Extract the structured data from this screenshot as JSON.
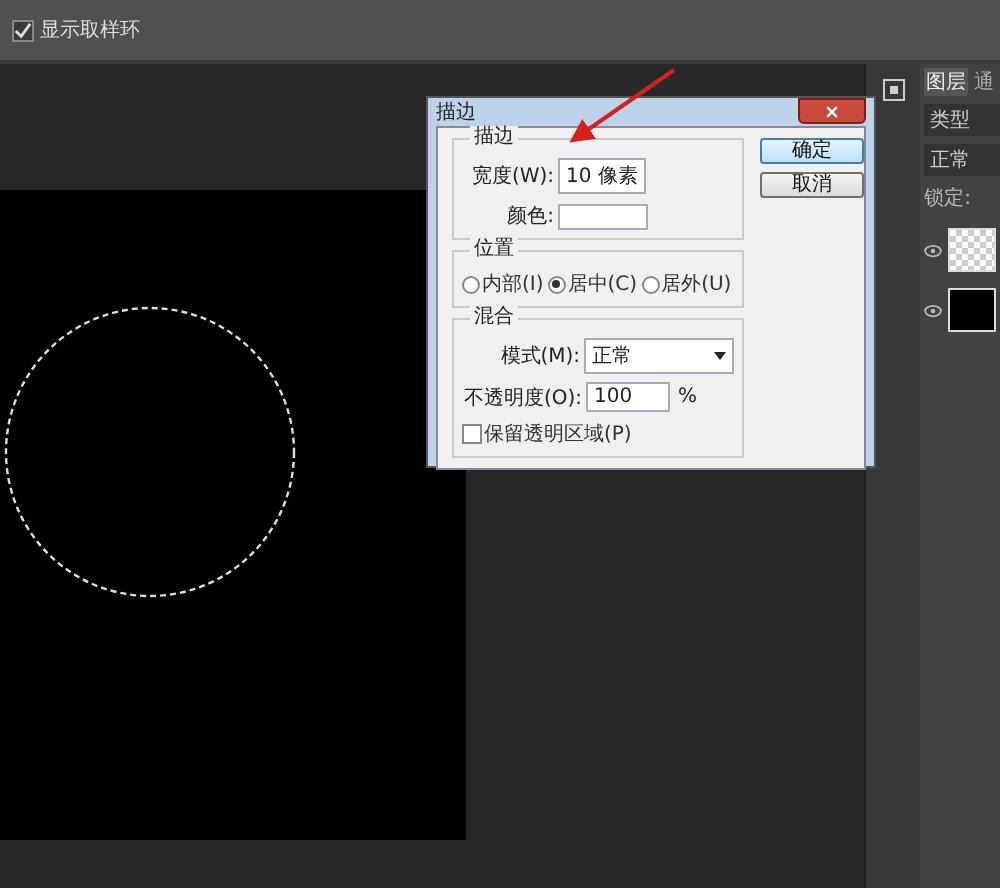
{
  "options_bar": {
    "sample_ring": {
      "label": "显示取样环",
      "checked": true
    }
  },
  "dialog": {
    "title": "描边",
    "stroke": {
      "legend": "描边",
      "width_label": "宽度(W):",
      "width_value": "10 像素",
      "color_label": "颜色:"
    },
    "position": {
      "legend": "位置",
      "options": [
        {
          "label": "内部(I)",
          "selected": false
        },
        {
          "label": "居中(C)",
          "selected": true
        },
        {
          "label": "居外(U)",
          "selected": false
        }
      ]
    },
    "blend": {
      "legend": "混合",
      "mode_label": "模式(M):",
      "mode_value": "正常",
      "opacity_label": "不透明度(O):",
      "opacity_value": "100",
      "opacity_unit": "%",
      "preserve": {
        "label": "保留透明区域(P)",
        "checked": false
      }
    },
    "buttons": [
      {
        "label": "确定",
        "default": true
      },
      {
        "label": "取消",
        "default": false
      }
    ]
  },
  "layers_panel": {
    "tabs": [
      {
        "label": "图层",
        "selected": true
      },
      {
        "label": "通",
        "selected": false
      }
    ],
    "filter": "类型",
    "blend_mode": "正常",
    "lock_label": "锁定:",
    "layers": [
      {
        "visible": true,
        "kind": "transparent"
      },
      {
        "visible": true,
        "kind": "black"
      }
    ]
  }
}
